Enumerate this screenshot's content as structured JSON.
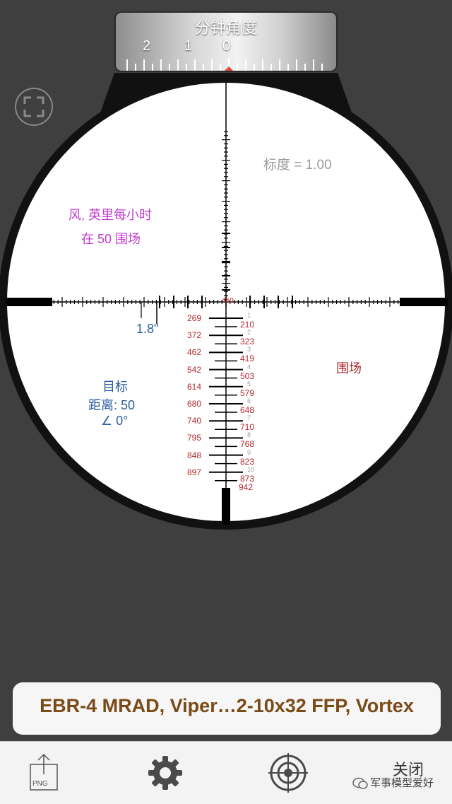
{
  "dial": {
    "title": "分钟角度",
    "numbers": [
      "2",
      "1",
      "0"
    ]
  },
  "reticle": {
    "mil_value_label": "标度 = 1.00",
    "wind_label": "风, 英里每小时",
    "wind_range_label": "在 50 围场",
    "holdover_label": "1.8\"",
    "target_label": "目标",
    "distance_label": "距离: 50",
    "angle_label": "∠ 0°",
    "range_unit_label": "围场",
    "range_top": "450",
    "range_left": [
      "269",
      "372",
      "462",
      "542",
      "614",
      "680",
      "740",
      "795",
      "848",
      "897"
    ],
    "range_right": [
      "210",
      "323",
      "419",
      "503",
      "579",
      "648",
      "710",
      "768",
      "823",
      "873"
    ],
    "mil_marks": [
      "1",
      "2",
      "3",
      "4",
      "5",
      "6",
      "7",
      "8",
      "9",
      "10"
    ],
    "range_bottom": "942"
  },
  "model_bar": {
    "text": "EBR-4 MRAD, Viper…2-10x32 FFP, Vortex"
  },
  "toolbar": {
    "export_label": "PNG",
    "close_label": "关闭",
    "watermark": "军事模型爱好"
  }
}
